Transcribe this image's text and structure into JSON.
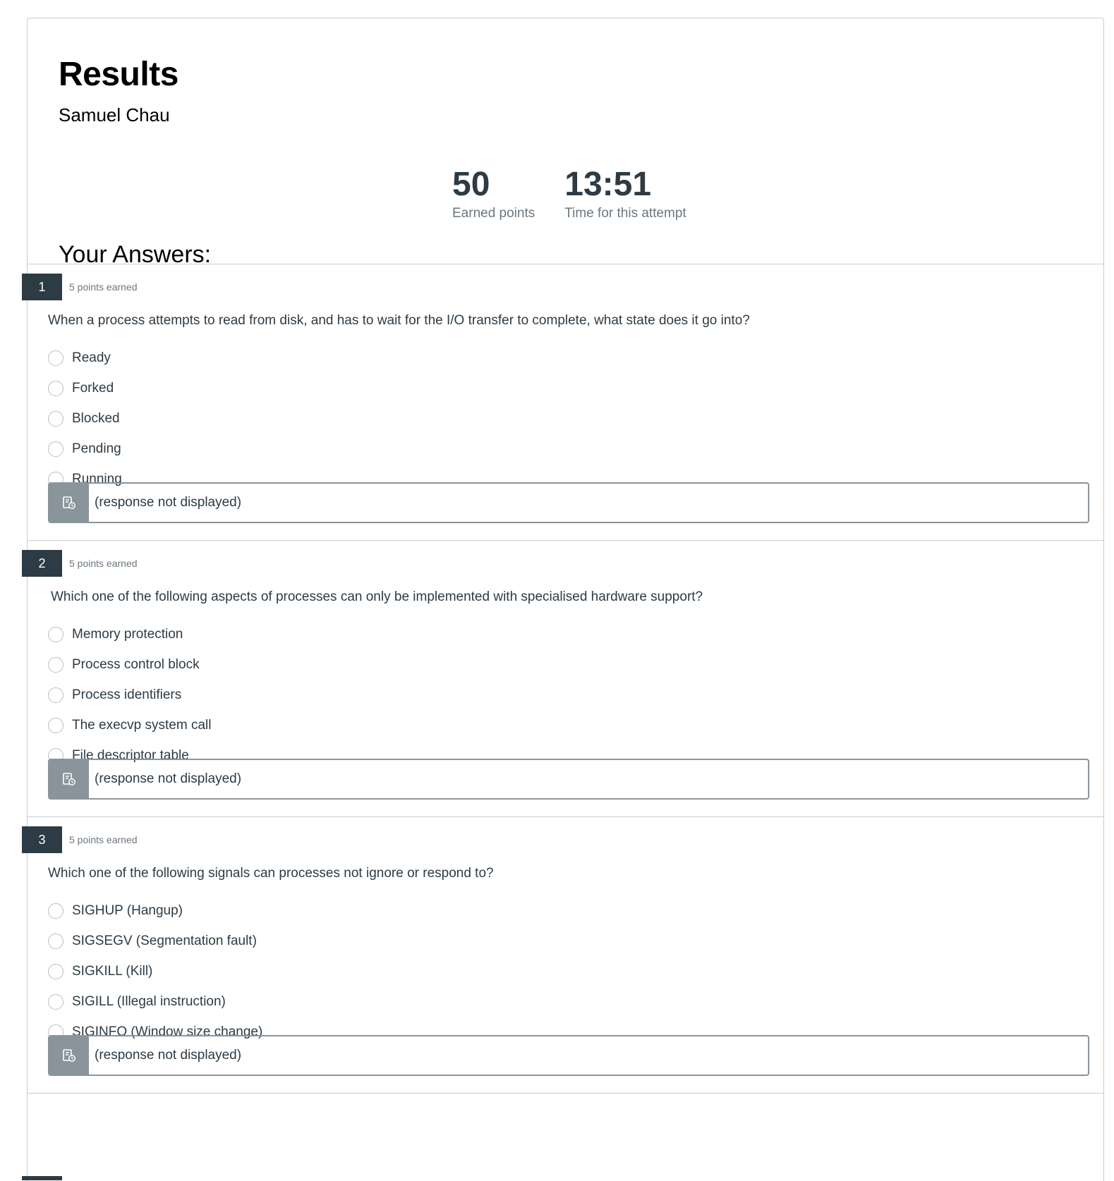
{
  "header": {
    "title": "Results",
    "student_name": "Samuel Chau"
  },
  "stats": {
    "score_value": "50",
    "score_label": "Earned points",
    "time_value": "13:51",
    "time_label": "Time for this attempt"
  },
  "answers_heading": "Your Answers:",
  "questions": [
    {
      "number": "1",
      "points": "5 points earned",
      "text": "When a process attempts to read from disk, and has to wait for the I/O transfer to complete, what state does it go into?",
      "options": [
        "Ready",
        "Forked",
        "Blocked",
        "Pending",
        "Running"
      ],
      "response": "(response not displayed)"
    },
    {
      "number": "2",
      "points": "5 points earned",
      "text": "Which one of the following aspects of processes can only be implemented with specialised hardware support?",
      "options": [
        "Memory protection",
        "Process control block",
        "Process identifiers",
        "The execvp system call",
        "File descriptor table"
      ],
      "response": "(response not displayed)"
    },
    {
      "number": "3",
      "points": "5 points earned",
      "text": "Which one of the following signals can processes not ignore or respond to?",
      "options": [
        "SIGHUP (Hangup)",
        "SIGSEGV (Segmentation fault)",
        "SIGKILL (Kill)",
        "SIGILL (Illegal instruction)",
        "SIGINFO (Window size change)"
      ],
      "response": "(response not displayed)"
    }
  ]
}
